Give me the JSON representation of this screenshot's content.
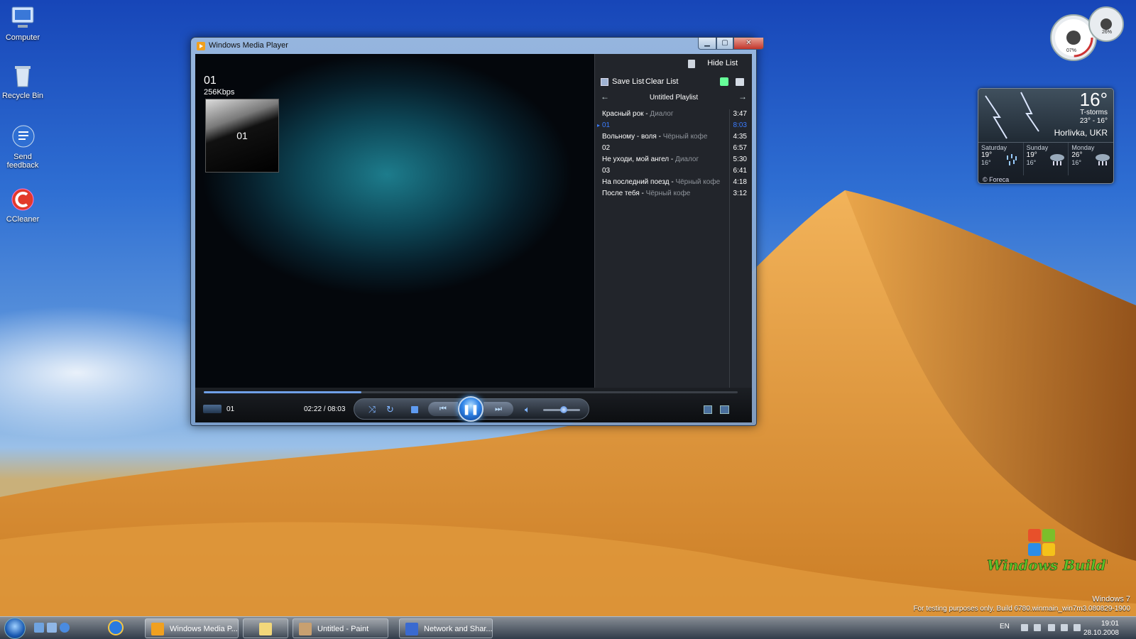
{
  "desktop": {
    "icons": [
      {
        "label": "Computer"
      },
      {
        "label": "Recycle Bin"
      },
      {
        "label": "Send feedback"
      },
      {
        "label": "CCleaner"
      }
    ],
    "watermark_line1": "Windows 7",
    "watermark_line2": "For testing purposes only. Build 6780.winmain_win7m3.080829-1900",
    "logo_text": "Windows Build's"
  },
  "weather": {
    "temp": "16°",
    "condition": "T-storms",
    "hi_lo": "23° - 16°",
    "city": "Horlivka, UKR",
    "days": [
      {
        "name": "Saturday",
        "hi": "19°",
        "lo": "16°"
      },
      {
        "name": "Sunday",
        "hi": "19°",
        "lo": "16°"
      },
      {
        "name": "Monday",
        "hi": "26°",
        "lo": "16°"
      }
    ],
    "provider": "© Foreca"
  },
  "meter": {
    "cpu": "07%",
    "mem": "26%"
  },
  "wmp": {
    "window_title": "Windows Media Player",
    "track_name": "01",
    "bitrate": "256Kbps",
    "album_label": "01",
    "playlist": {
      "hide_label": "Hide List",
      "save_label": "Save List",
      "clear_label": "Clear List",
      "name": "Untitled Playlist",
      "items": [
        {
          "title": "Красный рок",
          "artist": "Диалог",
          "duration": "3:47",
          "active": false
        },
        {
          "title": "01",
          "artist": "",
          "duration": "8:03",
          "active": true
        },
        {
          "title": "Вольному - воля",
          "artist": "Чёрный кофе",
          "duration": "4:35",
          "active": false
        },
        {
          "title": "02",
          "artist": "",
          "duration": "6:57",
          "active": false
        },
        {
          "title": "Не уходи, мой ангел",
          "artist": "Диалог",
          "duration": "5:30",
          "active": false
        },
        {
          "title": "03",
          "artist": "",
          "duration": "6:41",
          "active": false
        },
        {
          "title": "На последний поезд",
          "artist": "Чёрный кофе",
          "duration": "4:18",
          "active": false
        },
        {
          "title": "После тебя",
          "artist": "Чёрный кофе",
          "duration": "3:12",
          "active": false
        }
      ]
    },
    "transport": {
      "now_playing": "01",
      "time": "02:22 / 08:03",
      "progress_fraction": 0.295,
      "volume_fraction": 0.55
    }
  },
  "taskbar": {
    "tasks": [
      {
        "label": "Windows Media P..."
      },
      {
        "label": ""
      },
      {
        "label": "Untitled - Paint"
      },
      {
        "label": "Network and Shar..."
      }
    ],
    "lang": "EN",
    "time": "19:01",
    "date": "28.10.2008"
  },
  "colors": {
    "accent": "#3b7cff",
    "sky": "#2f6fd3",
    "sand": "#d9902d"
  }
}
